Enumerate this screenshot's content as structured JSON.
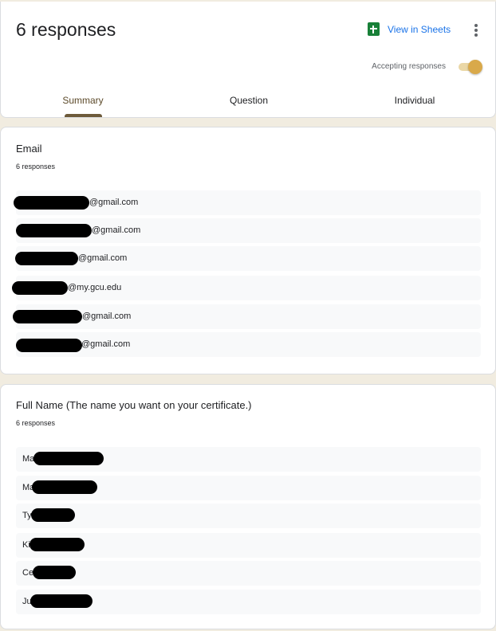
{
  "header": {
    "title": "6 responses",
    "view_in_sheets": "View in Sheets",
    "accepting_label": "Accepting responses",
    "accepting_on": true,
    "tabs": [
      {
        "label": "Summary",
        "active": true
      },
      {
        "label": "Question",
        "active": false
      },
      {
        "label": "Individual",
        "active": false
      }
    ]
  },
  "email_question": {
    "title": "Email",
    "count": "6 responses",
    "responses": [
      "@gmail.com",
      "@gmail.com",
      "@gmail.com",
      "@my.gcu.edu",
      "@gmail.com",
      "@gmail.com"
    ]
  },
  "name_question": {
    "title": "Full Name (The name you want on your certificate.)",
    "count": "6 responses",
    "responses": [
      "Ma",
      "Ma",
      "Ty",
      "Ki",
      "Ce",
      "Ju"
    ]
  },
  "colors": {
    "accent": "#6d5a3a",
    "toggle_knob": "#d9a94a",
    "link": "#1a73e8",
    "sheets_green": "#188038",
    "background": "#f1ece0"
  }
}
